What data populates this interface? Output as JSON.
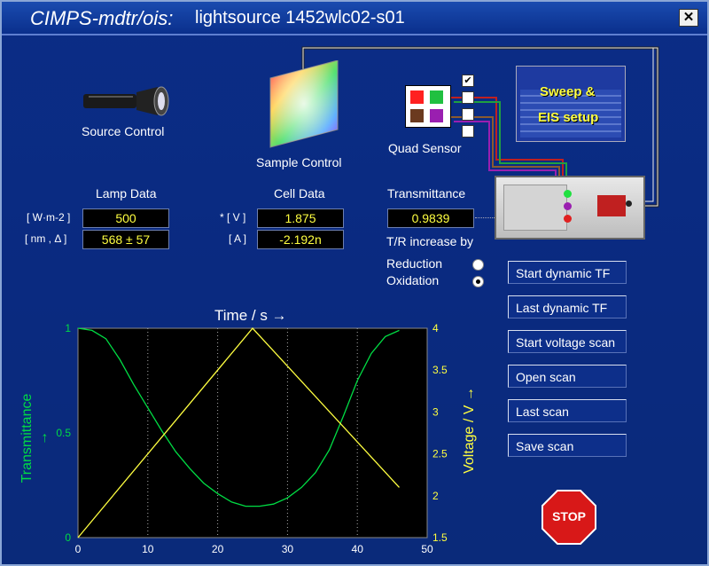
{
  "window": {
    "title_app": "CIMPS-mdtr/ois:",
    "title_file": "lightsource 1452wlc02-s01",
    "close_symbol": "✕"
  },
  "source_control": {
    "label": "Source Control",
    "icon": "flashlight-icon"
  },
  "sample_control": {
    "label": "Sample Control",
    "icon": "color-hexagon-icon"
  },
  "quad_sensor": {
    "label": "Quad Sensor",
    "colors": [
      "#ff2020",
      "#20c040",
      "#6b3a1f",
      "#9a1fb0"
    ],
    "checkboxes": [
      "✔",
      "",
      "",
      ""
    ]
  },
  "sweep": {
    "label_line1": "Sweep &",
    "label_line2": "EIS setup"
  },
  "lamp_data": {
    "header": "Lamp Data",
    "unit1": "[ W·m-2 ]",
    "value1": "500",
    "unit2": "[ nm , Δ ]",
    "value2": "568 ± 57"
  },
  "cell_data": {
    "header": "Cell Data",
    "unit1": "* [ V ]",
    "value1": "1.875",
    "unit2": "[ A ]",
    "value2": "-2.192n"
  },
  "transmittance": {
    "header": "Transmittance",
    "value": "0.9839"
  },
  "tr": {
    "label": "T/R increase by",
    "reduction": "Reduction",
    "oxidation": "Oxidation",
    "selected": "Oxidation"
  },
  "buttons": {
    "start_dynamic_tf": "Start dynamic TF",
    "last_dynamic_tf": "Last dynamic TF",
    "start_voltage_scan": "Start voltage scan",
    "open_scan": "Open scan",
    "last_scan": "Last scan",
    "save_scan": "Save scan",
    "stop": "STOP"
  },
  "colors": {
    "transmittance_axis": "#00dd44",
    "voltage_axis": "#ffff40",
    "background": "#0b2d86"
  },
  "chart_data": {
    "type": "line",
    "title": "",
    "xlabel": "Time / s →",
    "ylabel": "Transmittance →",
    "y2label": "Voltage / V →",
    "xlim": [
      0,
      50
    ],
    "ylim": [
      0,
      1
    ],
    "y2lim": [
      1.5,
      4
    ],
    "xticks": [
      "0",
      "10",
      "20",
      "30",
      "40",
      "50"
    ],
    "yticks": [
      "0",
      "0.5",
      "1"
    ],
    "y2ticks": [
      "1.5",
      "2",
      "2.5",
      "3",
      "3.5",
      "4"
    ],
    "grid_x": [
      10,
      20,
      30,
      40
    ],
    "series": [
      {
        "axis": "left",
        "color": "#00dd44",
        "x": [
          0,
          2,
          4,
          6,
          8,
          10,
          12,
          14,
          16,
          18,
          20,
          22,
          24,
          25,
          26,
          28,
          30,
          32,
          34,
          36,
          38,
          40,
          42,
          44,
          46
        ],
        "values": [
          1.0,
          0.99,
          0.95,
          0.85,
          0.73,
          0.62,
          0.51,
          0.41,
          0.33,
          0.26,
          0.21,
          0.17,
          0.15,
          0.15,
          0.15,
          0.16,
          0.19,
          0.24,
          0.31,
          0.42,
          0.58,
          0.75,
          0.88,
          0.96,
          0.99
        ]
      },
      {
        "axis": "right",
        "color": "#ffff40",
        "x": [
          0,
          25,
          46
        ],
        "values": [
          1.5,
          4.0,
          2.1
        ]
      }
    ]
  }
}
